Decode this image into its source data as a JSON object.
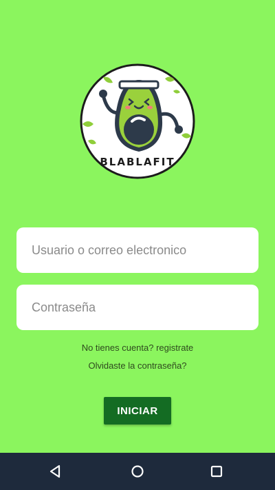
{
  "app": {
    "logo_text": "BLABLAFIT",
    "logo_icon": "avocado-mascot-icon"
  },
  "form": {
    "username_placeholder": "Usuario o correo electronico",
    "username_value": "",
    "password_placeholder": "Contraseña",
    "password_value": ""
  },
  "links": {
    "register": "No tienes cuenta? registrate",
    "forgot": "Olvidaste la contraseña?"
  },
  "button": {
    "login_label": "INICIAR"
  },
  "navbar": {
    "back_icon": "back-triangle-icon",
    "home_icon": "home-circle-icon",
    "recent_icon": "recent-apps-square-icon"
  },
  "colors": {
    "background": "#8bf55e",
    "button": "#146c23",
    "navbar": "#1e2a3c"
  }
}
